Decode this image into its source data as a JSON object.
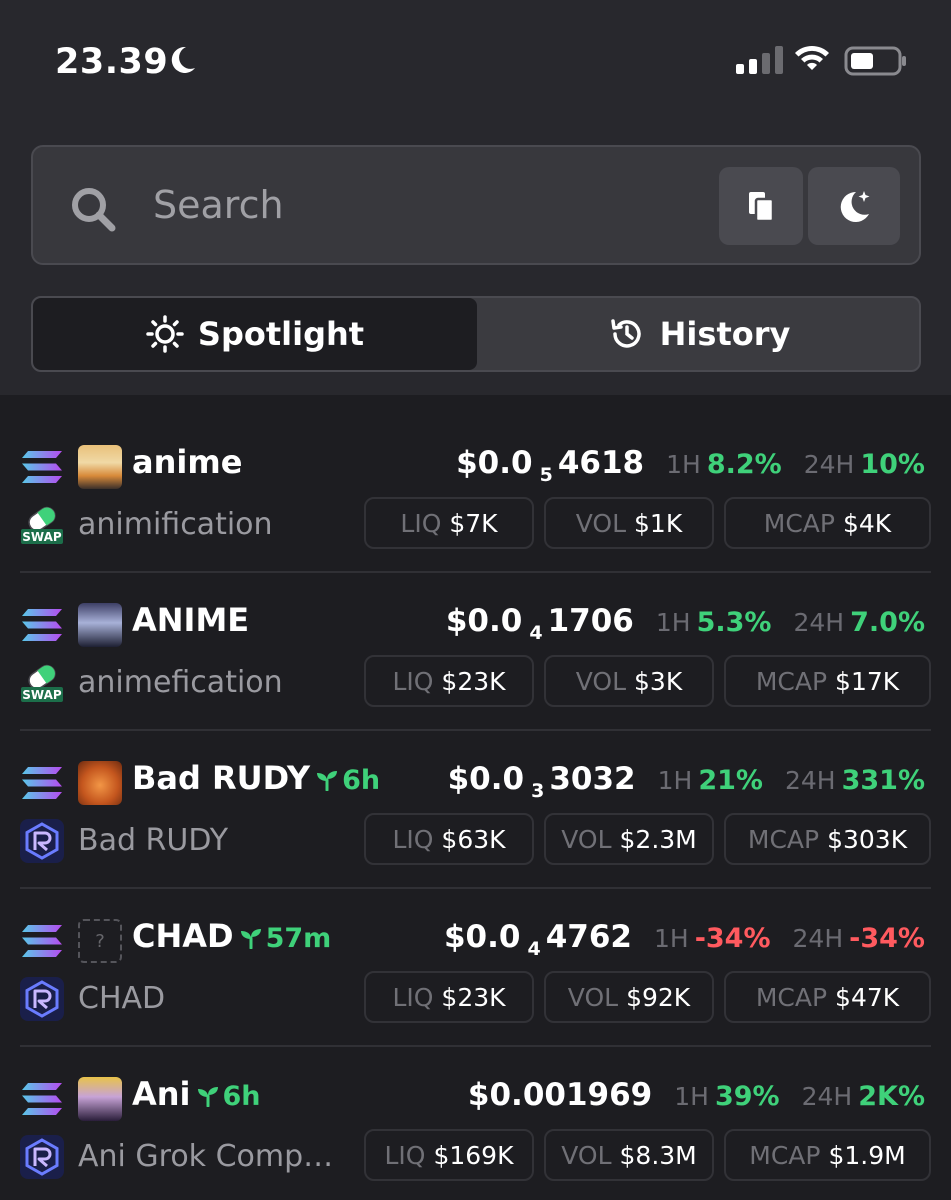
{
  "status_bar": {
    "time": "23.39"
  },
  "search": {
    "placeholder": "Search"
  },
  "tabs": [
    {
      "label": "Spotlight",
      "icon": "sun-icon",
      "active": true
    },
    {
      "label": "History",
      "icon": "history-icon",
      "active": false
    }
  ],
  "labels": {
    "h1": "1H",
    "h24": "24H",
    "liq": "LIQ",
    "vol": "VOL",
    "mcap": "MCAP"
  },
  "tokens": [
    {
      "symbol": "anime",
      "age": "",
      "name": "animification",
      "dex": "swap-icon",
      "price_prefix": "$0.0",
      "price_zeros": "5",
      "price_digits": "4618",
      "change_1h": "8.2%",
      "change_1h_sign": "pos",
      "change_24h": "10%",
      "change_24h_sign": "pos",
      "liq": "$7K",
      "vol": "$1K",
      "mcap": "$4K"
    },
    {
      "symbol": "ANIME",
      "age": "",
      "name": "animefication",
      "dex": "swap-icon",
      "price_prefix": "$0.0",
      "price_zeros": "4",
      "price_digits": "1706",
      "change_1h": "5.3%",
      "change_1h_sign": "pos",
      "change_24h": "7.0%",
      "change_24h_sign": "pos",
      "liq": "$23K",
      "vol": "$3K",
      "mcap": "$17K"
    },
    {
      "symbol": "Bad RUDY",
      "age": "6h",
      "name": "Bad RUDY",
      "dex": "raydium-icon",
      "price_prefix": "$0.0",
      "price_zeros": "3",
      "price_digits": "3032",
      "change_1h": "21%",
      "change_1h_sign": "pos",
      "change_24h": "331%",
      "change_24h_sign": "pos",
      "liq": "$63K",
      "vol": "$2.3M",
      "mcap": "$303K"
    },
    {
      "symbol": "CHAD",
      "age": "57m",
      "name": "CHAD",
      "dex": "raydium-icon",
      "price_prefix": "$0.0",
      "price_zeros": "4",
      "price_digits": "4762",
      "change_1h": "-34%",
      "change_1h_sign": "neg",
      "change_24h": "-34%",
      "change_24h_sign": "neg",
      "liq": "$23K",
      "vol": "$92K",
      "mcap": "$47K"
    },
    {
      "symbol": "Ani",
      "age": "6h",
      "name": "Ani Grok Compa...",
      "dex": "raydium-icon",
      "price_prefix": "$0.001969",
      "price_zeros": "",
      "price_digits": "",
      "change_1h": "39%",
      "change_1h_sign": "pos",
      "change_24h": "2K%",
      "change_24h_sign": "pos",
      "liq": "$169K",
      "vol": "$8.3M",
      "mcap": "$1.9M"
    }
  ],
  "colors": {
    "background": "#1d1d21",
    "panel": "#28282d",
    "positive": "#3fd17a",
    "negative": "#ff5a5f"
  }
}
